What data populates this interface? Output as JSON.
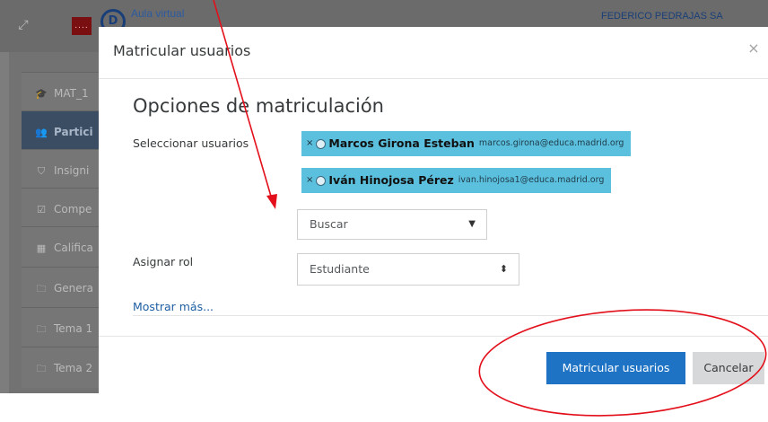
{
  "header": {
    "site_name": "Aula virtual",
    "cm_logo_text": "....",
    "aula_logo_text": "D",
    "user_name": "FEDERICO PEDRAJAS SA"
  },
  "sidebar": {
    "items": [
      {
        "label": "MAT_1",
        "icon": "graduation-cap-icon",
        "glyph": "🎓"
      },
      {
        "label": "Partici",
        "icon": "users-icon",
        "glyph": "👥"
      },
      {
        "label": "Insigni",
        "icon": "shield-icon",
        "glyph": "⛉"
      },
      {
        "label": "Compe",
        "icon": "checkbox-icon",
        "glyph": "☑"
      },
      {
        "label": "Califica",
        "icon": "table-icon",
        "glyph": "▦"
      },
      {
        "label": "Genera",
        "icon": "folder-icon",
        "glyph": "🗀"
      },
      {
        "label": "Tema 1",
        "icon": "folder-icon",
        "glyph": "🗀"
      },
      {
        "label": "Tema 2",
        "icon": "folder-icon",
        "glyph": "🗀"
      }
    ]
  },
  "modal": {
    "title": "Matricular usuarios",
    "close_glyph": "×",
    "section_title": "Opciones de matriculación",
    "users_label": "Seleccionar usuarios",
    "selected_users": [
      {
        "remove": "×",
        "name": "Marcos Girona Esteban",
        "email": "marcos.girona@educa.madrid.org"
      },
      {
        "remove": "×",
        "name": "Iván Hinojosa Pérez",
        "email": "ivan.hinojosa1@educa.madrid.org"
      }
    ],
    "search_placeholder": "Buscar",
    "search_caret": "▼",
    "role_label": "Asignar rol",
    "role_value": "Estudiante",
    "role_arrows": "⬍",
    "show_more": "Mostrar más...",
    "submit_label": "Matricular usuarios",
    "cancel_label": "Cancelar"
  },
  "colors": {
    "primary": "#1f73c4",
    "chip": "#5bc0de",
    "annotation": "#e3101b"
  }
}
